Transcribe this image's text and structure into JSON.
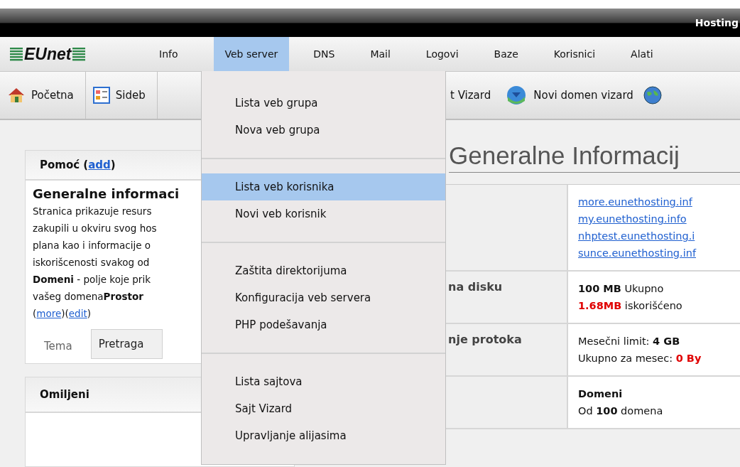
{
  "header": {
    "title": "Hosting"
  },
  "logo": {
    "text": "EUnet"
  },
  "menu_bar": [
    {
      "label": "Info",
      "selected": false
    },
    {
      "label": "Veb server",
      "selected": true
    },
    {
      "label": "DNS",
      "selected": false
    },
    {
      "label": "Mail",
      "selected": false
    },
    {
      "label": "Logovi",
      "selected": false
    },
    {
      "label": "Baze",
      "selected": false
    },
    {
      "label": "Korisnici",
      "selected": false
    },
    {
      "label": "Alati",
      "selected": false
    }
  ],
  "toolbar": [
    {
      "label": "Početna",
      "kind": "home"
    },
    {
      "label": "Sideb",
      "kind": "sidebar"
    }
  ],
  "toolbar_right": [
    {
      "label": "t Vizard",
      "kind": "text"
    },
    {
      "label": "Novi domen vizard",
      "kind": "sphere"
    },
    {
      "kind": "globe"
    }
  ],
  "help_panel": {
    "title": "Pomoć (",
    "title_link": "add",
    "title_close": ")",
    "heading": "Generalne informaci",
    "lines": [
      "Stranica prikazuje resurs",
      "zakupili u okviru svog hos",
      "plana kao i informacije o",
      "iskorišcenosti svakog od",
      "**Domeni** - polje koje prik",
      "vašeg domena**Prostor**"
    ],
    "link_line": [
      {
        "kind": "text",
        "text": "("
      },
      {
        "kind": "link",
        "text": "more"
      },
      {
        "kind": "text",
        "text": ")("
      },
      {
        "kind": "link",
        "text": "edit"
      },
      {
        "kind": "text",
        "text": ")"
      }
    ],
    "tabs": [
      {
        "label": "Tema",
        "selected": true
      },
      {
        "label": "Pretraga",
        "selected": false
      }
    ]
  },
  "favorites_panel": {
    "title": "Omiljeni"
  },
  "main": {
    "title": "Generalne Informacij",
    "rows": [
      {
        "links": [
          "more.eunethosting.inf",
          "my.eunethosting.info",
          "nhptest.eunethosting.i",
          "sunce.eunethosting.inf"
        ]
      },
      {
        "label": "na disku",
        "lines": [
          [
            {
              "kind": "plain",
              "text": "**100 MB** Ukupno"
            }
          ],
          [
            {
              "kind": "alert",
              "text": "1.68MB"
            },
            {
              "kind": "plain",
              "text": " iskorišćeno"
            }
          ]
        ]
      },
      {
        "label": "nje protoka",
        "lines": [
          [
            {
              "kind": "plain",
              "text": "Mesečni limit: **4 GB**"
            }
          ],
          [
            {
              "kind": "plain",
              "text": "Ukupno za mesec: "
            },
            {
              "kind": "alert",
              "text": "0 By"
            }
          ]
        ]
      },
      {
        "lines": [
          [
            {
              "kind": "plain",
              "text": "**Domeni**"
            }
          ],
          [
            {
              "kind": "plain",
              "text": "Od **100** domena"
            }
          ]
        ]
      }
    ]
  },
  "dropdown": {
    "groups": [
      [
        {
          "label": "Lista veb grupa",
          "selected": false
        },
        {
          "label": "Nova veb grupa",
          "selected": false
        }
      ],
      [
        {
          "label": "Lista veb korisnika",
          "selected": true
        },
        {
          "label": "Novi veb korisnik",
          "selected": false
        }
      ],
      [
        {
          "label": "Zaštita direktorijuma",
          "selected": false
        },
        {
          "label": "Konfiguracija veb servera",
          "selected": false
        },
        {
          "label": "PHP podešavanja",
          "selected": false
        }
      ],
      [
        {
          "label": "Lista sajtova",
          "selected": false
        },
        {
          "label": "Sajt Vizard",
          "selected": false
        },
        {
          "label": "Upravljanje alijasima",
          "selected": false
        }
      ]
    ]
  }
}
